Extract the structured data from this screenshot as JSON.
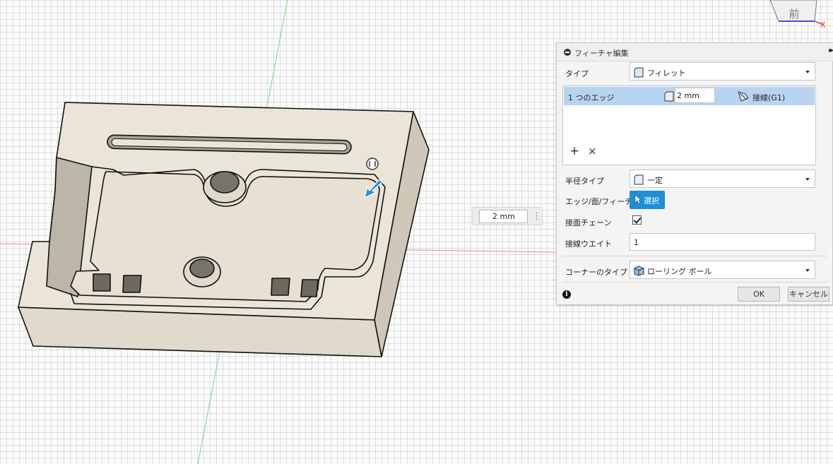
{
  "viewport": {
    "dimension_input": "2 mm",
    "viewcube_face": "前",
    "axis_label": "X"
  },
  "dialog": {
    "title": "フィーチャ編集",
    "type_label": "タイプ",
    "type_value": "フィレット",
    "edge_row": {
      "name": "1 つのエッジ",
      "radius": "2 mm",
      "continuity": "接線(G1)"
    },
    "radius_type_label": "半径タイプ",
    "radius_type_value": "一定",
    "edge_select_label": "エッジ/面/フィーチャ",
    "select_button": "選択",
    "tangent_chain_label": "接面チェーン",
    "tangent_chain_checked": true,
    "tangent_weight_label": "接線ウエイト",
    "tangent_weight_value": "1",
    "corner_type_label": "コーナーのタイプ",
    "corner_type_value": "ローリング ボール",
    "ok": "OK",
    "cancel": "キャンセル"
  },
  "colors": {
    "accent": "#1d8fd6",
    "selected_row": "#b9d4f3",
    "model_face": "#ece6da",
    "grid_axis_red": "#e88a8a",
    "grid_axis_green": "#7fd08a"
  }
}
